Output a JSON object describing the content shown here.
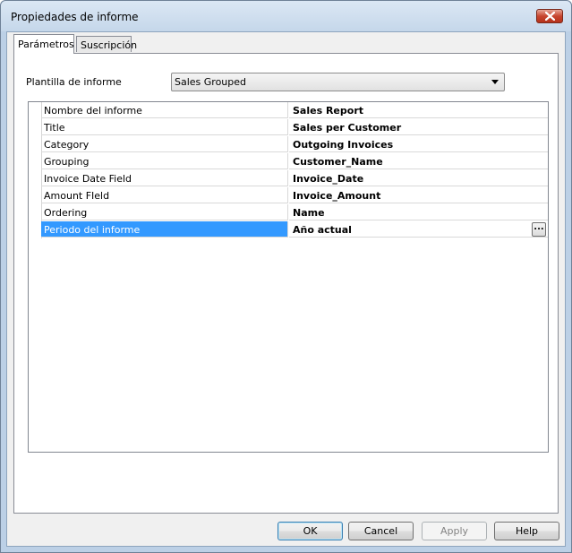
{
  "window": {
    "title": "Propiedades de informe",
    "close_icon": "close-icon"
  },
  "tabs": [
    {
      "label": "Parámetros",
      "active": true
    },
    {
      "label": "Suscripción",
      "active": false
    }
  ],
  "template": {
    "label": "Plantilla de informe",
    "value": "Sales Grouped",
    "arrow_icon": "dropdown-arrow-icon"
  },
  "properties": [
    {
      "name": "Nombre del informe",
      "value": "Sales Report"
    },
    {
      "name": "Title",
      "value": "Sales per Customer"
    },
    {
      "name": "Category",
      "value": "Outgoing Invoices"
    },
    {
      "name": "Grouping",
      "value": "Customer_Name"
    },
    {
      "name": "Invoice Date Field",
      "value": "Invoice_Date"
    },
    {
      "name": "Amount FIeld",
      "value": "Invoice_Amount"
    },
    {
      "name": "Ordering",
      "value": "Name"
    },
    {
      "name": "Periodo del informe",
      "value": "Año actual",
      "selected": true,
      "ellipsis": "..."
    }
  ],
  "buttons": {
    "ok": "OK",
    "cancel": "Cancel",
    "apply": "Apply",
    "help": "Help"
  },
  "colors": {
    "selection": "#3399ff",
    "frame": "#bcd0e6"
  }
}
